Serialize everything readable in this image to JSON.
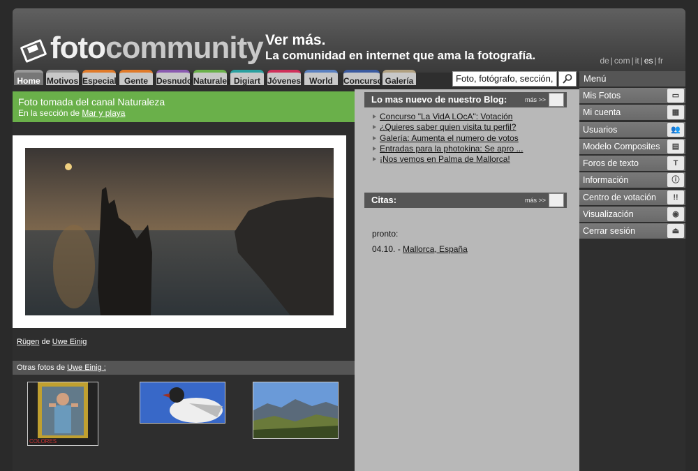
{
  "header": {
    "logo_part1": "foto",
    "logo_part2": "community",
    "tagline_main": "Ver más.",
    "tagline_sub": "La comunidad en internet que ama la fotografía.",
    "languages": [
      "de",
      "com",
      "it",
      "es",
      "fr"
    ],
    "selected_language": "es"
  },
  "tabs": [
    {
      "label": "Home",
      "color": "#777777"
    },
    {
      "label": "Motivos",
      "color": "#9a9a9a"
    },
    {
      "label": "Especial",
      "color": "#e07a2a"
    },
    {
      "label": "Gente",
      "color": "#e07a2a"
    },
    {
      "label": "Desnudo",
      "color": "#8a5ab0"
    },
    {
      "label": "Naturaleza",
      "color": "#6ab04a"
    },
    {
      "label": "Digiart",
      "color": "#2aa0a0"
    },
    {
      "label": "Jóvenes",
      "color": "#d0305a"
    },
    {
      "label": "World",
      "color": "#5a80c0"
    },
    {
      "label": "Concursos",
      "color": "#3a5aa0"
    },
    {
      "label": "Galería",
      "color": "#b0a080"
    }
  ],
  "search": {
    "value": "Foto, fotógrafo, sección,"
  },
  "menu": {
    "title": "Menú",
    "items": [
      {
        "label": "Mis Fotos",
        "icon": "photos-icon"
      },
      {
        "label": "Mi cuenta",
        "icon": "account-icon"
      },
      {
        "label": "Usuarios",
        "icon": "users-icon"
      },
      {
        "label": "Modelo Composites",
        "icon": "composites-icon"
      },
      {
        "label": "Foros de texto",
        "icon": "text-forum-icon"
      },
      {
        "label": "Información",
        "icon": "info-icon"
      },
      {
        "label": "Centro de votación",
        "icon": "voting-icon"
      },
      {
        "label": "Visualización",
        "icon": "eye-icon"
      },
      {
        "label": "Cerrar sesión",
        "icon": "eject-icon"
      }
    ]
  },
  "channel": {
    "title": "Foto tomada del canal Naturaleza",
    "section_prefix": "En la sección de",
    "section_link": "Mar y playa"
  },
  "photo": {
    "title": "Rügen",
    "by": "de",
    "author": "Uwe Einig"
  },
  "others": {
    "prefix": "Otras fotos de",
    "author": "Uwe Einig :",
    "thumb_caption": "COLORES"
  },
  "blog": {
    "title": "Lo mas nuevo de nuestro Blog:",
    "more": "más >>",
    "items": [
      "Concurso \"La VidA LOcA\": Votación",
      "¿Quieres saber quien visita tu perfil?",
      "Galería: Aumenta el numero de votos",
      "Entradas para la photokina: Se apro ...",
      "¡Nos vemos en Palma de Mallorca!"
    ]
  },
  "citas": {
    "title": "Citas:",
    "more": "más >>",
    "soon": "pronto:",
    "date": "04.10. -",
    "place": "Mallorca, España"
  }
}
